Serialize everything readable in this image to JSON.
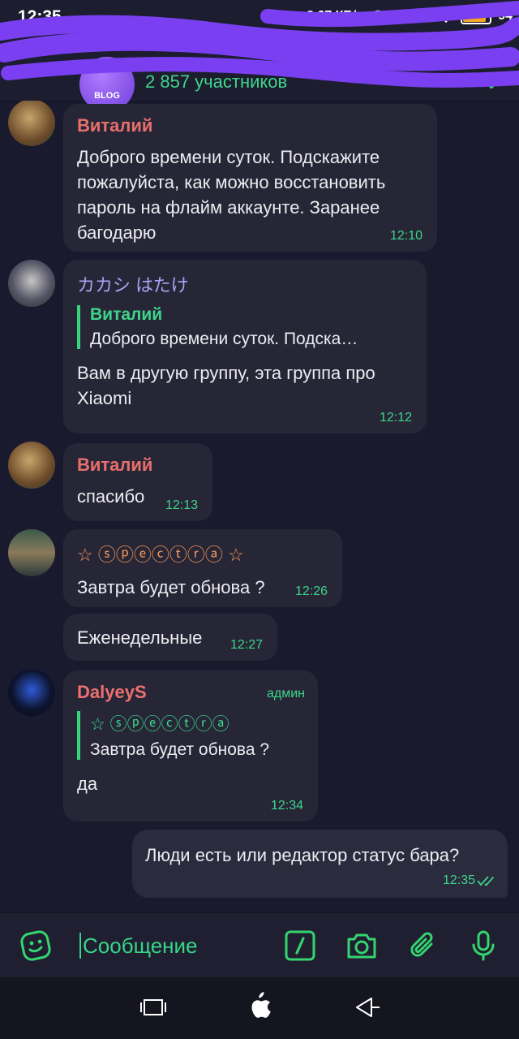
{
  "status_bar": {
    "time": "12:35",
    "net_speed": "2,67 КБ/с",
    "battery": "94",
    "battery_level": 0.94
  },
  "header": {
    "avatar_label": "BLOG",
    "subtitle": "2 857 участников"
  },
  "messages": [
    {
      "author": "Виталий",
      "author_color": "#e8706a",
      "text": "Доброго времени суток. Подскажите пожалуйста, как можно восстановить пароль на флайм аккаунте. Заранее багодарю",
      "time": "12:10"
    },
    {
      "author": "カカシ はたけ",
      "author_color": "#a9a3f5",
      "reply_author": "Виталий",
      "reply_text": "Доброго времени суток. Подска…",
      "text": "Вам в другую группу, эта группа про Xiaomi",
      "time": "12:12"
    },
    {
      "author": "Виталий",
      "author_color": "#e8706a",
      "text": "спасибо",
      "time": "12:13"
    },
    {
      "author": "☆ ⓢⓟⓔⓒⓣⓡⓐ ☆",
      "author_color": "#f0955a",
      "text": "Завтра будет обнова ?",
      "time": "12:26"
    },
    {
      "text": "Еженедельные",
      "time": "12:27"
    },
    {
      "author": "DalyeyS",
      "author_color": "#ef6f6f",
      "badge": "админ",
      "reply_author": "☆ ⓢⓟⓔⓒⓣⓡⓐ",
      "reply_text": "Завтра будет обнова ?",
      "text": "да",
      "time": "12:34"
    }
  ],
  "outgoing": {
    "text": "Люди есть или редактор статус бара?",
    "time": "12:35"
  },
  "input": {
    "placeholder": "Сообщение"
  },
  "icons": {
    "emoji": "sticker-icon",
    "commands": "slash-command-icon",
    "camera": "camera-icon",
    "attach": "paperclip-icon",
    "mic": "microphone-icon"
  },
  "colors": {
    "accent": "#34d46f",
    "bubble": "#262637",
    "background": "#1a1a2e"
  }
}
